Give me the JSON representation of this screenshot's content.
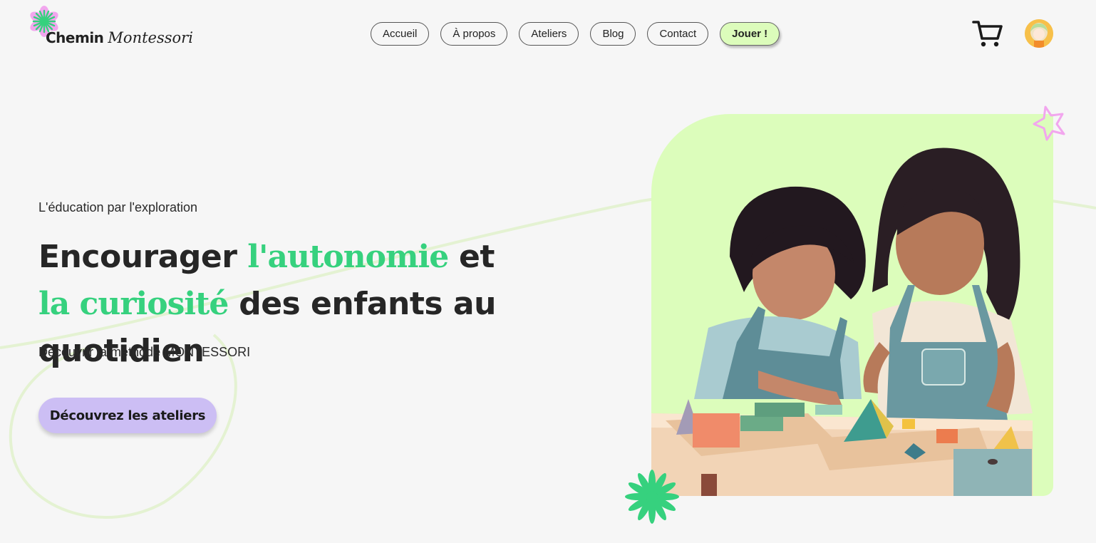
{
  "brand": {
    "name_bold": "Chemin",
    "name_italic": "Montessori"
  },
  "nav": {
    "items": [
      "Accueil",
      "À propos",
      "Ateliers",
      "Blog",
      "Contact"
    ],
    "play_label": "Jouer !"
  },
  "header_icons": {
    "cart": "cart-icon",
    "avatar": "user-avatar"
  },
  "hero": {
    "eyebrow": "L'éducation par l'exploration",
    "headline_part1": "Encourager ",
    "headline_hl1": "l'autonomie",
    "headline_part2": " et",
    "headline_hl2": "la curiosité",
    "headline_part3": " des enfants au quotidien",
    "subline": "Découvrir la méthode MONTESSORI",
    "cta_label": "Découvrez les ateliers",
    "image_alt": "Deux enfants jouant avec des formes géométriques Montessori"
  },
  "colors": {
    "accent_green": "#36d17e",
    "card_bg": "#dcfdbb",
    "cta_bg": "#ccbef4",
    "pink": "#f2a6ee"
  }
}
